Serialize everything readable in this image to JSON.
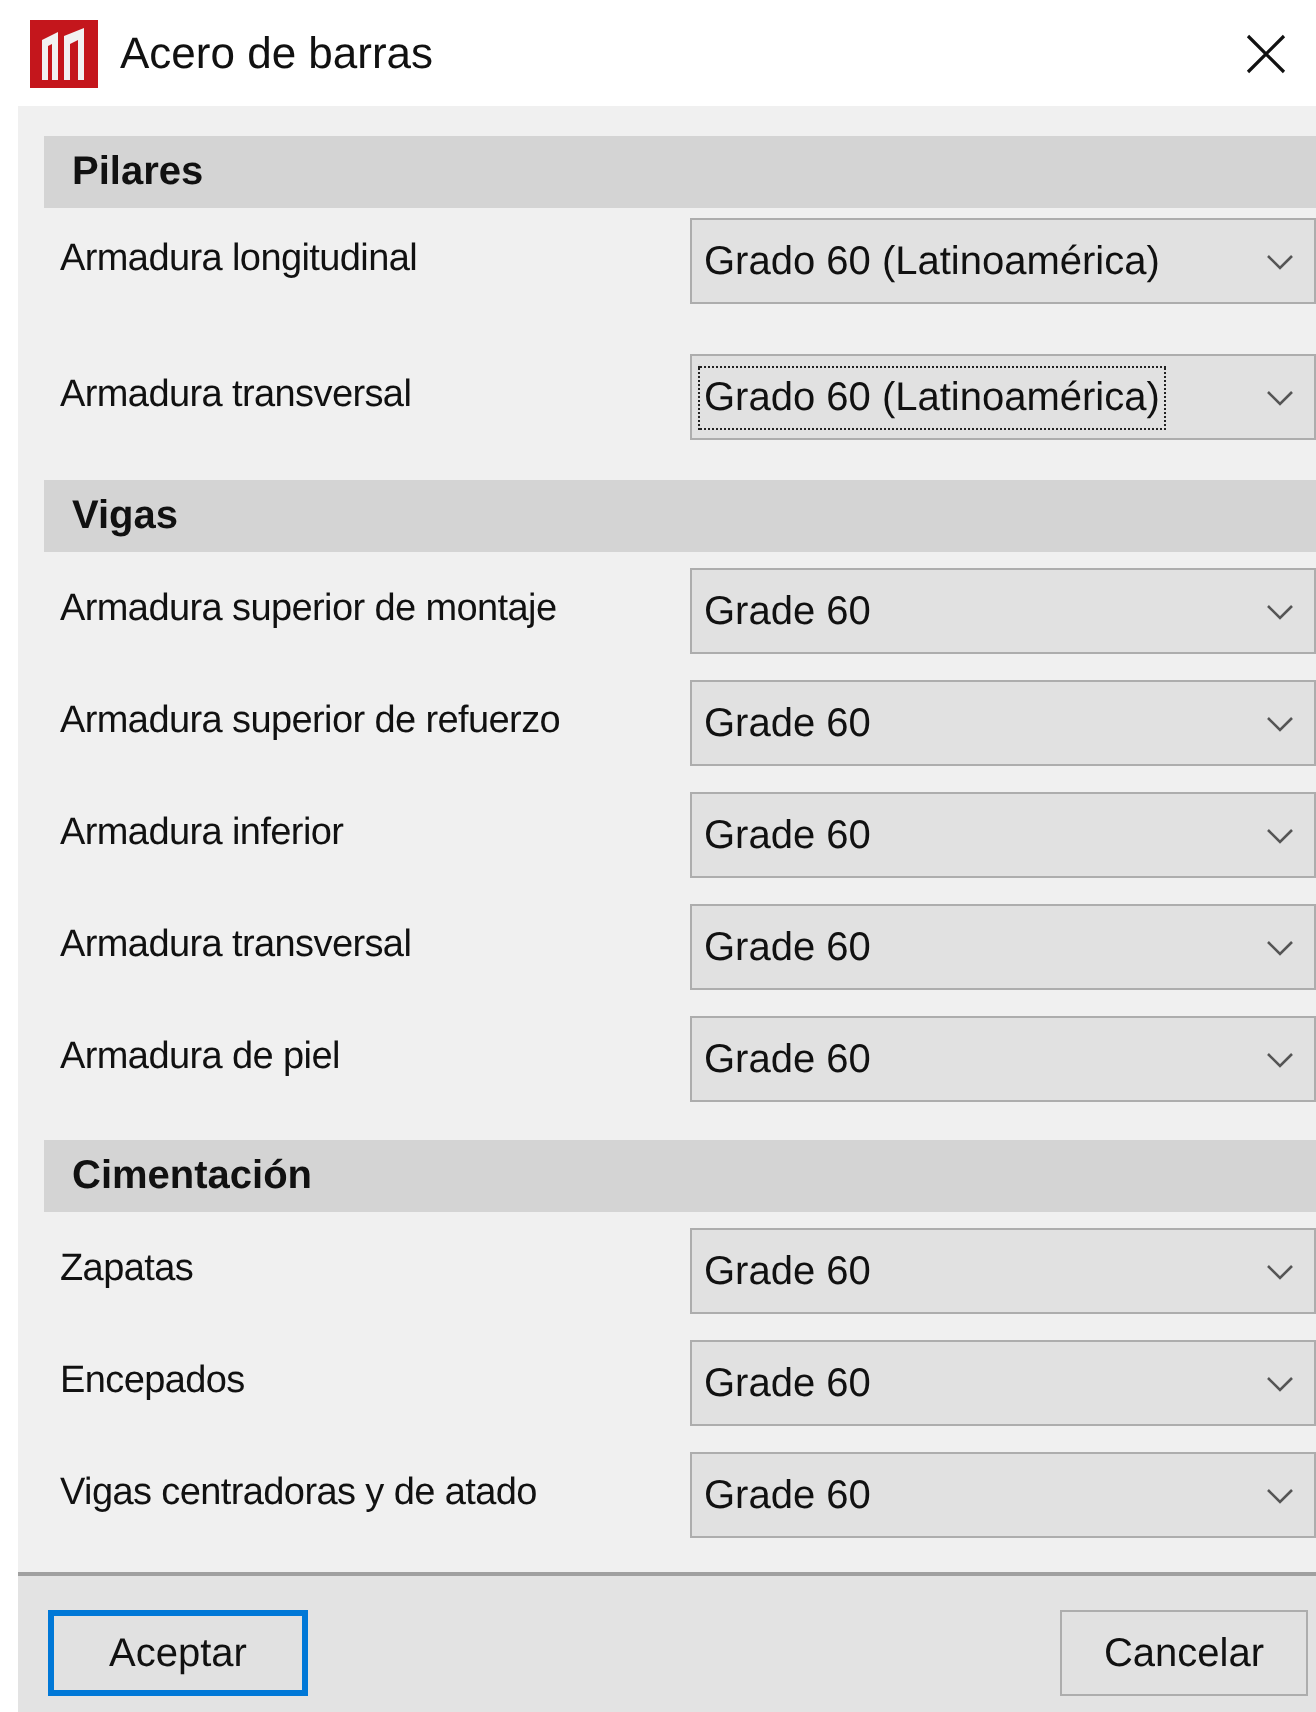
{
  "window": {
    "title": "Acero de barras"
  },
  "sections": [
    {
      "title": "Pilares",
      "rows": [
        {
          "label": "Armadura longitudinal",
          "value": "Grado 60 (Latinoamérica)",
          "focused": false
        },
        {
          "label": "Armadura transversal",
          "value": "Grado 60 (Latinoamérica)",
          "focused": true
        }
      ]
    },
    {
      "title": "Vigas",
      "rows": [
        {
          "label": "Armadura superior de montaje",
          "value": "Grade 60",
          "focused": false
        },
        {
          "label": "Armadura superior de refuerzo",
          "value": "Grade 60",
          "focused": false
        },
        {
          "label": "Armadura inferior",
          "value": "Grade 60",
          "focused": false
        },
        {
          "label": "Armadura transversal",
          "value": "Grade 60",
          "focused": false
        },
        {
          "label": "Armadura de piel",
          "value": "Grade 60",
          "focused": false
        }
      ]
    },
    {
      "title": "Cimentación",
      "rows": [
        {
          "label": "Zapatas",
          "value": "Grade 60",
          "focused": false
        },
        {
          "label": "Encepados",
          "value": "Grade 60",
          "focused": false
        },
        {
          "label": "Vigas centradoras y de atado",
          "value": "Grade 60",
          "focused": false
        }
      ]
    }
  ],
  "buttons": [
    {
      "label": "Aceptar",
      "default": true
    },
    {
      "label": "Cancelar",
      "default": false
    }
  ]
}
